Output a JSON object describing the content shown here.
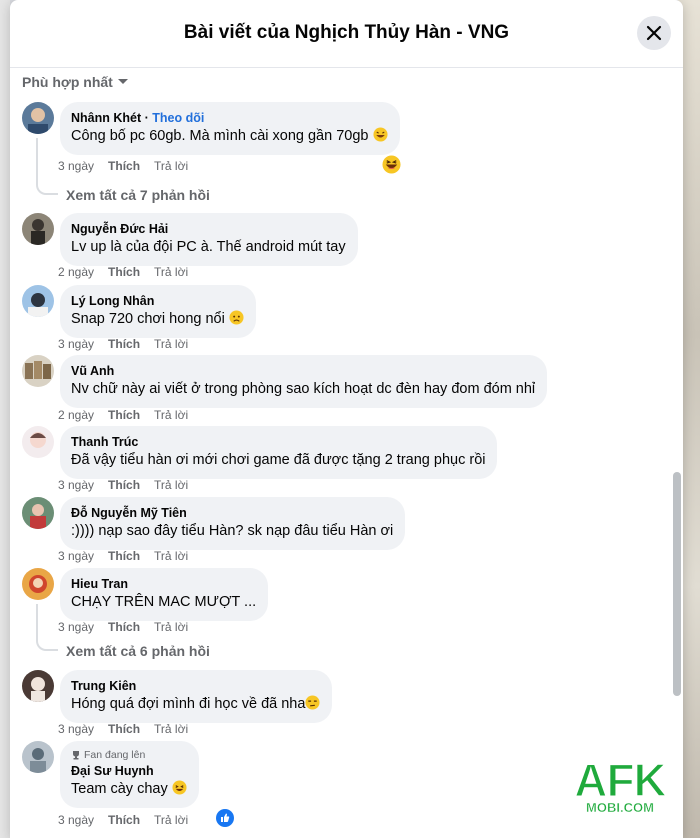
{
  "header": {
    "title": "Bài viết của Nghịch Thủy Hàn - VNG"
  },
  "sort": {
    "label": "Phù hợp nhất"
  },
  "actions": {
    "like": "Thích",
    "reply": "Trả lời"
  },
  "comments": [
    {
      "author": "Nhânn Khét",
      "follow": "Theo dõi",
      "text": "Công bố pc 60gb. Mà mình cài xong gần 70gb",
      "time": "3 ngày",
      "replies": "Xem tất cả 7 phản hồi"
    },
    {
      "author": "Nguyễn Đức Hải",
      "text": "Lv up là của đội PC à. Thế android mút tay",
      "time": "2 ngày"
    },
    {
      "author": "Lý Long Nhân",
      "text": "Snap 720 chơi hong nổi",
      "time": "3 ngày"
    },
    {
      "author": "Vũ Anh",
      "text": "Nv chữ này ai viết ở trong phòng sao kích hoạt dc đèn hay đom đóm nhỉ",
      "time": "2 ngày"
    },
    {
      "author": "Thanh Trúc",
      "text": "Đã vậy tiểu hàn ơi mới chơi game đã được tặng 2 trang phục rồi",
      "time": "3 ngày"
    },
    {
      "author": "Đỗ Nguyễn Mỹ Tiên",
      "text": ":)))) nạp sao đây tiểu Hàn? sk nạp đâu tiểu Hàn ơi",
      "time": "3 ngày"
    },
    {
      "author": "Hieu Tran",
      "text": "CHẠY TRÊN MAC MƯỢT ...",
      "time": "3 ngày",
      "replies": "Xem tất cả 6 phản hồi"
    },
    {
      "author": "Trung Kiên",
      "text": "Hóng quá đợi mình đi học về đã nha",
      "time": "3 ngày"
    },
    {
      "badge": "Fan đang lên",
      "author": "Đại Sư Huynh",
      "text": "Team cày chay",
      "time": "3 ngày"
    }
  ],
  "watermark": {
    "brand": "AFK",
    "site": "MOBI.COM"
  },
  "colors": {
    "link": "#216fdb",
    "bubble": "#f0f2f5",
    "watermark": "#1faa3c"
  }
}
